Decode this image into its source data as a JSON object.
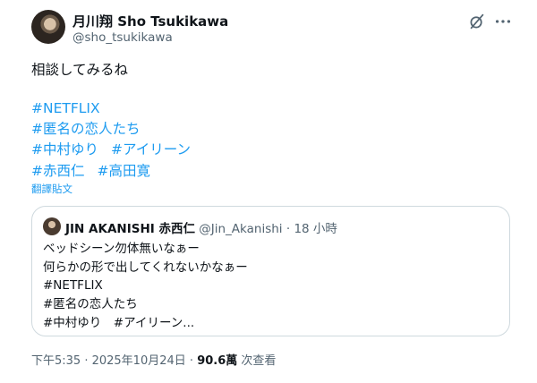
{
  "author": {
    "name": "月川翔 Sho Tsukikawa",
    "handle": "@sho_tsukikawa"
  },
  "header": {
    "grok_icon": "grok-icon",
    "more_icon": "more-icon"
  },
  "post": {
    "text": "相談してみるね",
    "hashtag_lines": [
      [
        "#NETFLIX"
      ],
      [
        "#匿名の恋人たち"
      ],
      [
        "#中村ゆり",
        "#アイリーン"
      ],
      [
        "#赤西仁",
        "#高田寛"
      ]
    ],
    "translate_label": "翻譯貼文"
  },
  "quote": {
    "name": "JIN AKANISHI 赤西仁",
    "handle": "@Jin_Akanishi",
    "separator": "·",
    "time": "18 小時",
    "lines": [
      "ベッドシーン勿体無いなぁー",
      "何らかの形で出してくれないかなぁー",
      "#NETFLIX",
      "#匿名の恋人たち",
      "#中村ゆり　#アイリーン..."
    ]
  },
  "footer": {
    "timestamp": "下午5:35 · 2025年10月24日",
    "separator": "·",
    "views": "90.6萬",
    "views_label": "次查看"
  }
}
